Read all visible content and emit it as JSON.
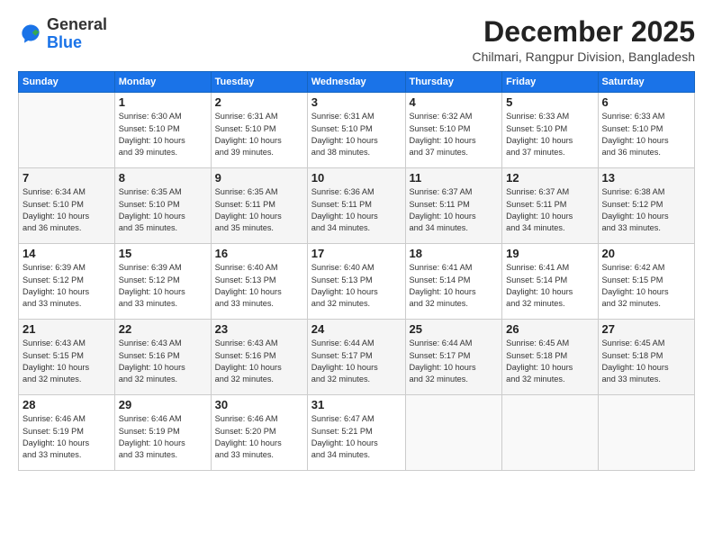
{
  "logo": {
    "general": "General",
    "blue": "Blue"
  },
  "header": {
    "title": "December 2025",
    "subtitle": "Chilmari, Rangpur Division, Bangladesh"
  },
  "weekdays": [
    "Sunday",
    "Monday",
    "Tuesday",
    "Wednesday",
    "Thursday",
    "Friday",
    "Saturday"
  ],
  "weeks": [
    [
      {
        "day": "",
        "empty": true
      },
      {
        "day": "1",
        "sunrise": "6:30 AM",
        "sunset": "5:10 PM",
        "daylight": "10 hours and 39 minutes."
      },
      {
        "day": "2",
        "sunrise": "6:31 AM",
        "sunset": "5:10 PM",
        "daylight": "10 hours and 39 minutes."
      },
      {
        "day": "3",
        "sunrise": "6:31 AM",
        "sunset": "5:10 PM",
        "daylight": "10 hours and 38 minutes."
      },
      {
        "day": "4",
        "sunrise": "6:32 AM",
        "sunset": "5:10 PM",
        "daylight": "10 hours and 37 minutes."
      },
      {
        "day": "5",
        "sunrise": "6:33 AM",
        "sunset": "5:10 PM",
        "daylight": "10 hours and 37 minutes."
      },
      {
        "day": "6",
        "sunrise": "6:33 AM",
        "sunset": "5:10 PM",
        "daylight": "10 hours and 36 minutes."
      }
    ],
    [
      {
        "day": "7",
        "sunrise": "6:34 AM",
        "sunset": "5:10 PM",
        "daylight": "10 hours and 36 minutes."
      },
      {
        "day": "8",
        "sunrise": "6:35 AM",
        "sunset": "5:10 PM",
        "daylight": "10 hours and 35 minutes."
      },
      {
        "day": "9",
        "sunrise": "6:35 AM",
        "sunset": "5:11 PM",
        "daylight": "10 hours and 35 minutes."
      },
      {
        "day": "10",
        "sunrise": "6:36 AM",
        "sunset": "5:11 PM",
        "daylight": "10 hours and 34 minutes."
      },
      {
        "day": "11",
        "sunrise": "6:37 AM",
        "sunset": "5:11 PM",
        "daylight": "10 hours and 34 minutes."
      },
      {
        "day": "12",
        "sunrise": "6:37 AM",
        "sunset": "5:11 PM",
        "daylight": "10 hours and 34 minutes."
      },
      {
        "day": "13",
        "sunrise": "6:38 AM",
        "sunset": "5:12 PM",
        "daylight": "10 hours and 33 minutes."
      }
    ],
    [
      {
        "day": "14",
        "sunrise": "6:39 AM",
        "sunset": "5:12 PM",
        "daylight": "10 hours and 33 minutes."
      },
      {
        "day": "15",
        "sunrise": "6:39 AM",
        "sunset": "5:12 PM",
        "daylight": "10 hours and 33 minutes."
      },
      {
        "day": "16",
        "sunrise": "6:40 AM",
        "sunset": "5:13 PM",
        "daylight": "10 hours and 33 minutes."
      },
      {
        "day": "17",
        "sunrise": "6:40 AM",
        "sunset": "5:13 PM",
        "daylight": "10 hours and 32 minutes."
      },
      {
        "day": "18",
        "sunrise": "6:41 AM",
        "sunset": "5:14 PM",
        "daylight": "10 hours and 32 minutes."
      },
      {
        "day": "19",
        "sunrise": "6:41 AM",
        "sunset": "5:14 PM",
        "daylight": "10 hours and 32 minutes."
      },
      {
        "day": "20",
        "sunrise": "6:42 AM",
        "sunset": "5:15 PM",
        "daylight": "10 hours and 32 minutes."
      }
    ],
    [
      {
        "day": "21",
        "sunrise": "6:43 AM",
        "sunset": "5:15 PM",
        "daylight": "10 hours and 32 minutes."
      },
      {
        "day": "22",
        "sunrise": "6:43 AM",
        "sunset": "5:16 PM",
        "daylight": "10 hours and 32 minutes."
      },
      {
        "day": "23",
        "sunrise": "6:43 AM",
        "sunset": "5:16 PM",
        "daylight": "10 hours and 32 minutes."
      },
      {
        "day": "24",
        "sunrise": "6:44 AM",
        "sunset": "5:17 PM",
        "daylight": "10 hours and 32 minutes."
      },
      {
        "day": "25",
        "sunrise": "6:44 AM",
        "sunset": "5:17 PM",
        "daylight": "10 hours and 32 minutes."
      },
      {
        "day": "26",
        "sunrise": "6:45 AM",
        "sunset": "5:18 PM",
        "daylight": "10 hours and 32 minutes."
      },
      {
        "day": "27",
        "sunrise": "6:45 AM",
        "sunset": "5:18 PM",
        "daylight": "10 hours and 33 minutes."
      }
    ],
    [
      {
        "day": "28",
        "sunrise": "6:46 AM",
        "sunset": "5:19 PM",
        "daylight": "10 hours and 33 minutes."
      },
      {
        "day": "29",
        "sunrise": "6:46 AM",
        "sunset": "5:19 PM",
        "daylight": "10 hours and 33 minutes."
      },
      {
        "day": "30",
        "sunrise": "6:46 AM",
        "sunset": "5:20 PM",
        "daylight": "10 hours and 33 minutes."
      },
      {
        "day": "31",
        "sunrise": "6:47 AM",
        "sunset": "5:21 PM",
        "daylight": "10 hours and 34 minutes."
      },
      {
        "day": "",
        "empty": true
      },
      {
        "day": "",
        "empty": true
      },
      {
        "day": "",
        "empty": true
      }
    ]
  ],
  "labels": {
    "sunrise": "Sunrise:",
    "sunset": "Sunset:",
    "daylight": "Daylight:"
  }
}
